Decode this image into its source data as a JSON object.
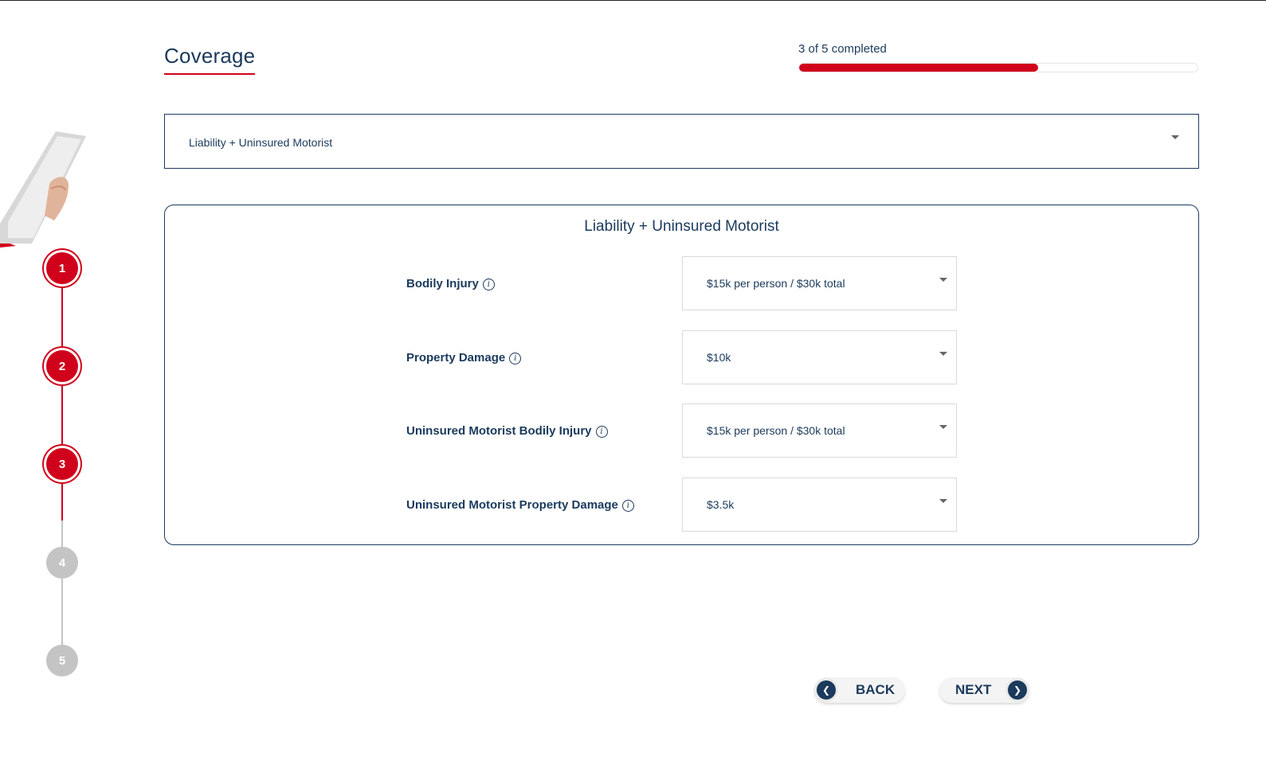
{
  "header": {
    "title": "Coverage",
    "progress_text": "3 of 5 completed",
    "progress_fraction": 0.6
  },
  "stepper": {
    "steps": [
      {
        "label": "1",
        "state": "done"
      },
      {
        "label": "2",
        "state": "done"
      },
      {
        "label": "3",
        "state": "current"
      },
      {
        "label": "4",
        "state": "todo"
      },
      {
        "label": "5",
        "state": "todo"
      }
    ]
  },
  "coverage_select": {
    "value": "Liability + Uninsured Motorist"
  },
  "card": {
    "title": "Liability + Uninsured Motorist",
    "rows": [
      {
        "label": "Bodily Injury",
        "value": "$15k per person / $30k total"
      },
      {
        "label": "Property Damage",
        "value": "$10k"
      },
      {
        "label": "Uninsured Motorist Bodily Injury",
        "value": "$15k per person / $30k total"
      },
      {
        "label": "Uninsured Motorist Property Damage",
        "value": "$3.5k"
      }
    ]
  },
  "nav": {
    "back_label": "BACK",
    "next_label": "NEXT"
  },
  "icons": {
    "info": "info-icon",
    "back": "chevron-left-icon",
    "next": "chevron-right-icon",
    "caret": "caret-down-icon"
  },
  "colors": {
    "accent": "#d0021b",
    "primary": "#1b3a5c",
    "inactive": "#c4c4c4"
  }
}
